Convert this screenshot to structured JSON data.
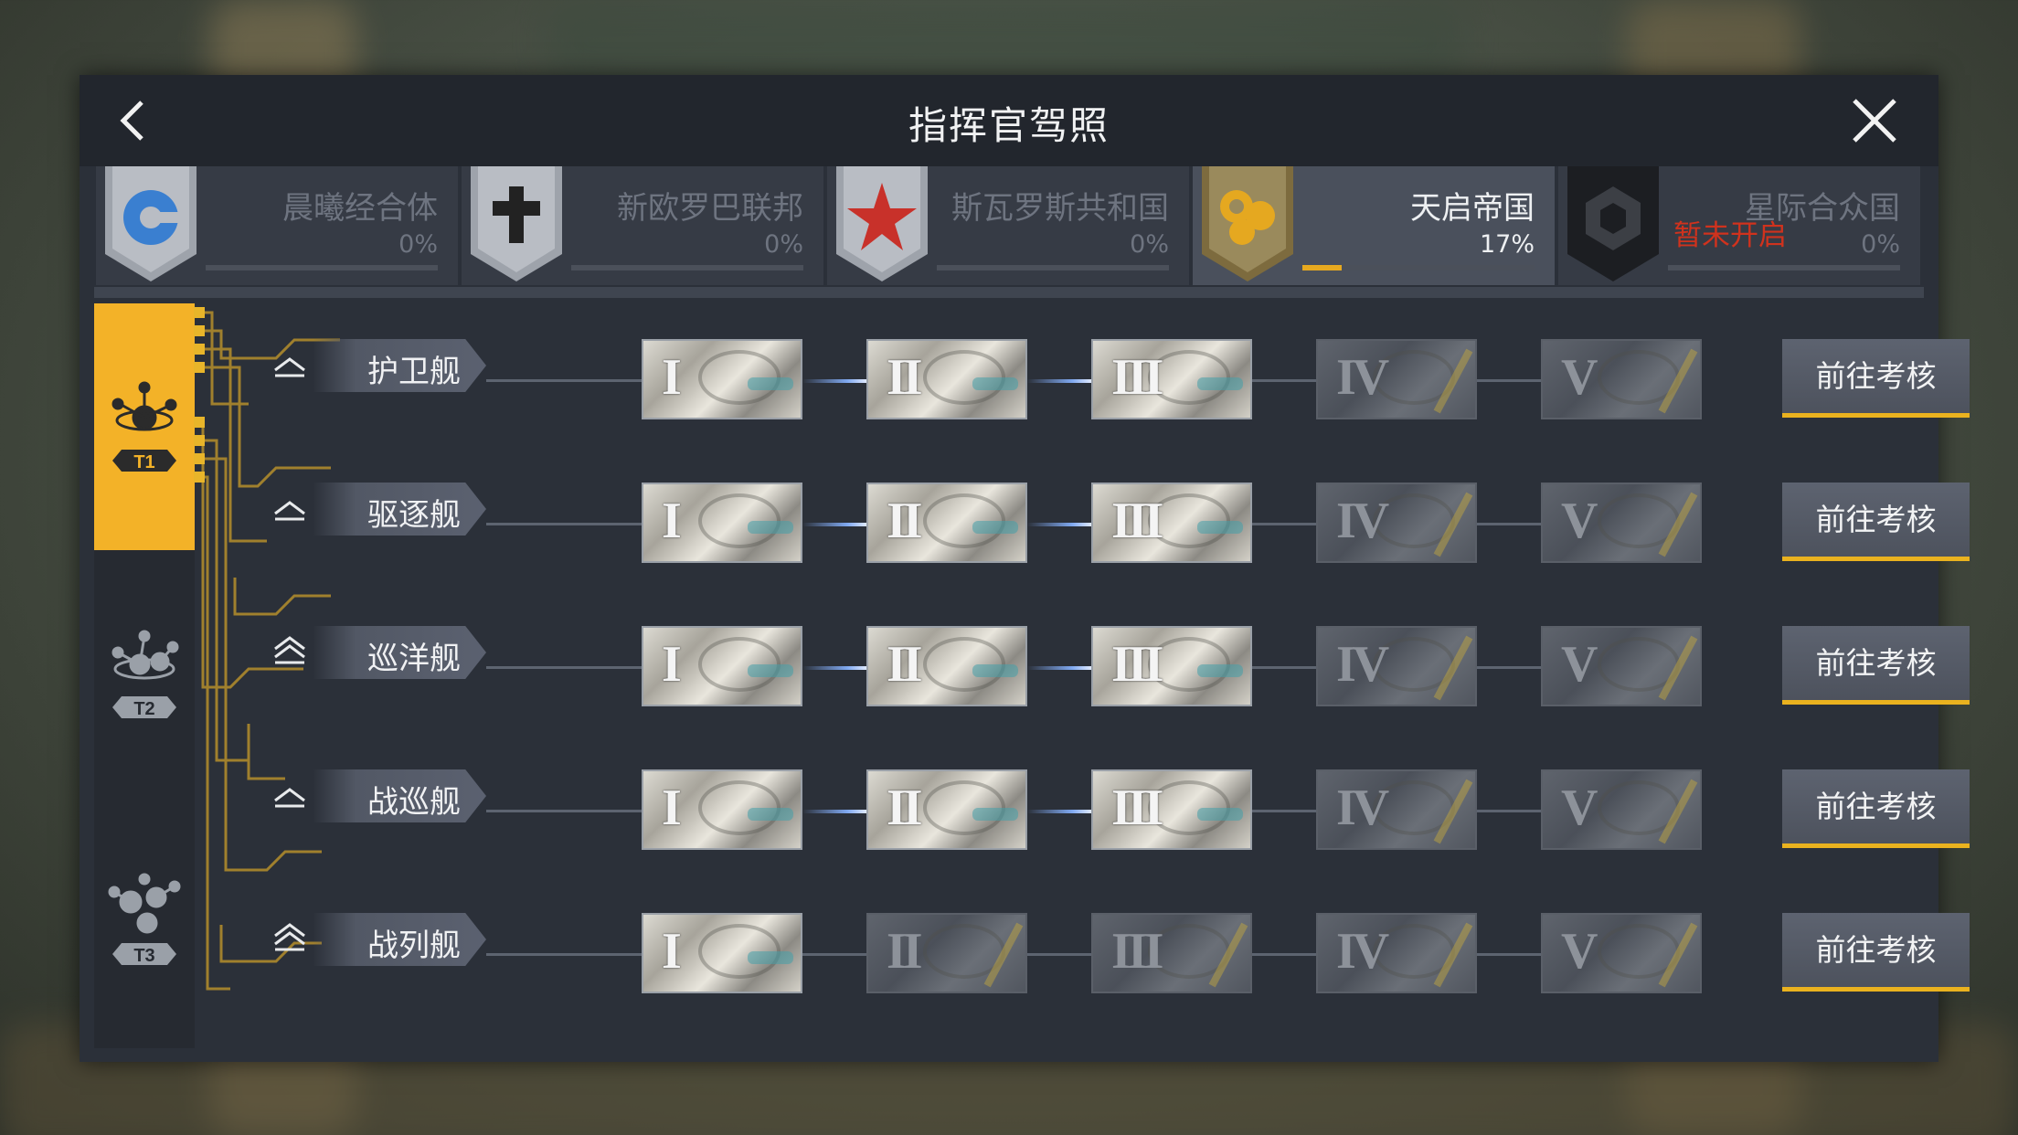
{
  "window": {
    "title": "指挥官驾照"
  },
  "icons": {
    "back": "chevron-left-icon",
    "close": "close-icon"
  },
  "factions": [
    {
      "name": "晨曦经合体",
      "percent": "0%",
      "progress": 0,
      "emblem": "dawn-orb-emblem",
      "color": "#3a7fd0",
      "locked": ""
    },
    {
      "name": "新欧罗巴联邦",
      "percent": "0%",
      "progress": 0,
      "emblem": "cross-emblem",
      "color": "#222222",
      "locked": ""
    },
    {
      "name": "斯瓦罗斯共和国",
      "percent": "0%",
      "progress": 0,
      "emblem": "red-star-emblem",
      "color": "#c8312a",
      "locked": ""
    },
    {
      "name": "天启帝国",
      "percent": "17%",
      "progress": 0.17,
      "emblem": "gold-cluster-emblem",
      "color": "#e5a820",
      "locked": "",
      "active": true
    },
    {
      "name": "星际合众国",
      "percent": "0%",
      "progress": 0,
      "emblem": "hex-cube-emblem",
      "color": "#1b1b1b",
      "locked": "暂未开启"
    }
  ],
  "tiers": [
    {
      "label": "T1",
      "active": true
    },
    {
      "label": "T2",
      "active": false
    },
    {
      "label": "T3",
      "active": false
    }
  ],
  "ship_rows": [
    {
      "type": "护卫舰",
      "chevrons": 1,
      "unlocked": 3,
      "button": "前往考核"
    },
    {
      "type": "驱逐舰",
      "chevrons": 1,
      "unlocked": 3,
      "button": "前往考核"
    },
    {
      "type": "巡洋舰",
      "chevrons": 2,
      "unlocked": 3,
      "button": "前往考核"
    },
    {
      "type": "战巡舰",
      "chevrons": 1,
      "unlocked": 3,
      "button": "前往考核"
    },
    {
      "type": "战列舰",
      "chevrons": 2,
      "unlocked": 1,
      "button": "前往考核"
    }
  ],
  "levels": [
    "I",
    "II",
    "III",
    "IV",
    "V"
  ],
  "colors": {
    "accent": "#f3b228",
    "panel": "#2b3039",
    "locked_text": "#d0321d"
  }
}
